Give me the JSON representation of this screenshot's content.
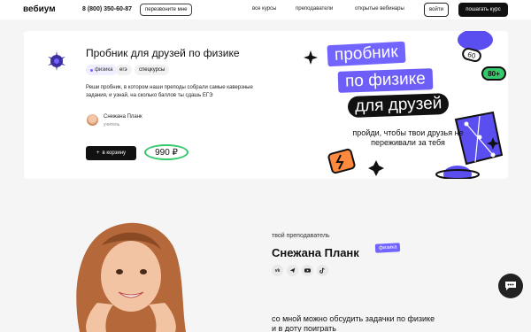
{
  "header": {
    "logo": "вебиум",
    "phone": "8 (800) 350-60-87",
    "callback": "перезвоните мне",
    "nav": [
      "все курсы",
      "преподаватели",
      "открытые вебинары"
    ],
    "login": "войти",
    "buy": "пошагать курс"
  },
  "course": {
    "title": "Пробник для друзей по физике",
    "tags": [
      "физика",
      "егэ",
      "спецкурсы"
    ],
    "description": "Реши пробник, в котором наши преподы собрали самые каверзные задания, и узнай, на сколько баллов ты сдашь ЕГЭ",
    "teacher_name": "Снежана Планк",
    "teacher_role": "учитель",
    "cart_button": "в корзину",
    "price": "990 ₽"
  },
  "promo": {
    "line1": "пробник",
    "line2": "по физике",
    "line3": "для друзей",
    "sub1": "пройди, чтобы твои друзья не",
    "sub2": "переживали за тебя",
    "score_old": "60",
    "score_new": "80+"
  },
  "teacher_section": {
    "label": "твой преподаватель",
    "name": "Снежана Планк",
    "subject_badge": "физика",
    "socials": [
      "vk",
      "tg",
      "yt",
      "tt"
    ],
    "text1": "со мной можно обсудить задачки по физике",
    "text2": "и в доту поиграть"
  },
  "colors": {
    "accent": "#7264ff",
    "green": "#36c96b",
    "dark": "#111111"
  }
}
